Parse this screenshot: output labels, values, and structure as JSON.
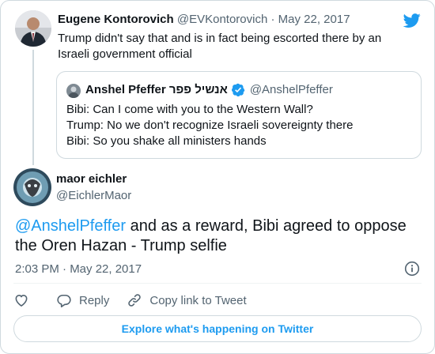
{
  "brand": {
    "accent": "#1d9bf0",
    "logo_icon": "twitter-bird-icon"
  },
  "parent_tweet": {
    "author_name": "Eugene Kontorovich",
    "handle": "@EVKontorovich",
    "separator": "·",
    "date": "May 22, 2017",
    "text": "Trump didn't say that and is in fact being escorted there by an Israeli government official"
  },
  "quoted_tweet": {
    "author_name": "Anshel Pfeffer אנשיל פפר",
    "verified_icon": "verified-badge-icon",
    "handle": "@AnshelPfeffer",
    "lines": [
      "Bibi: Can I come with you to the Western Wall?",
      "Trump: No we don't recognize Israeli sovereignty there",
      "Bibi: So you shake all ministers hands"
    ]
  },
  "main_tweet": {
    "author_name": "maor eichler",
    "handle": "@EichlerMaor",
    "mention": "@AnshelPfeffer",
    "text": " and as a reward, Bibi agreed to oppose the Oren Hazan - Trump selfie",
    "timestamp": "2:03 PM · May 22, 2017",
    "info_icon": "info-icon"
  },
  "actions": {
    "like_icon": "heart-icon",
    "reply_label": "Reply",
    "copy_link_label": "Copy link to Tweet"
  },
  "explore_button": {
    "label": "Explore what's happening on Twitter"
  }
}
